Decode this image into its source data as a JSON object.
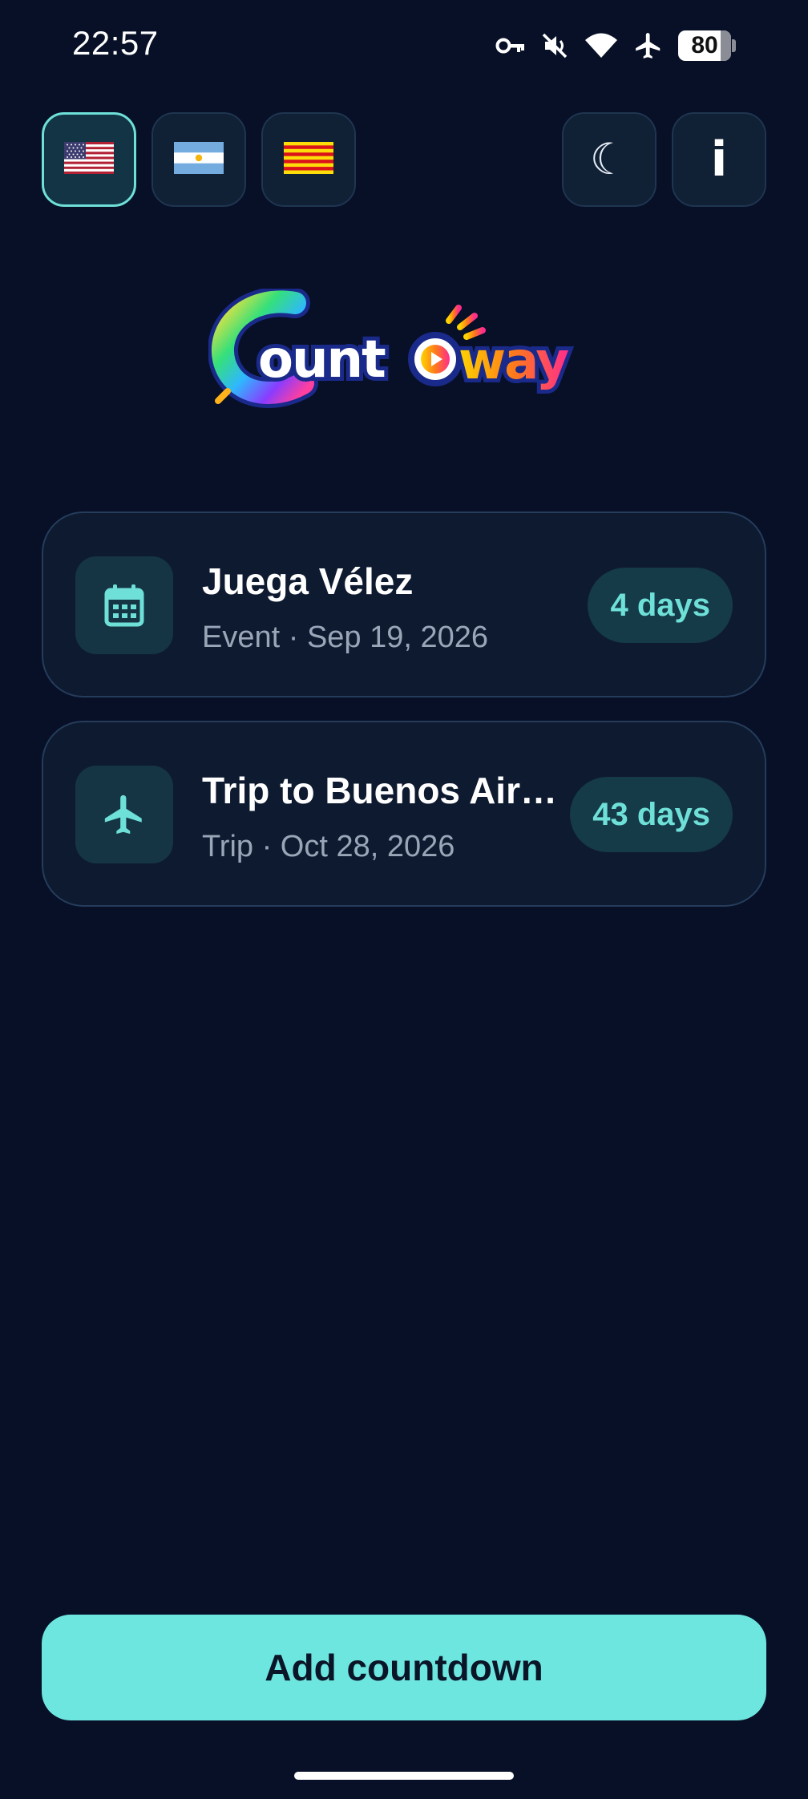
{
  "status_bar": {
    "time": "22:57",
    "battery_level": "80",
    "icons": [
      "vpn-key-icon",
      "mute-icon",
      "wifi-icon",
      "airplane-mode-icon",
      "battery-icon"
    ]
  },
  "toolbar": {
    "languages": [
      {
        "name": "us-flag-icon",
        "selected": true
      },
      {
        "name": "argentina-flag-icon",
        "selected": false
      },
      {
        "name": "catalonia-flag-icon",
        "selected": false
      }
    ],
    "theme_glyph": "☾",
    "info_glyph": "i"
  },
  "logo": {
    "text": "CountAway"
  },
  "countdowns": [
    {
      "icon": "calendar-icon",
      "title": "Juega Vélez",
      "subtitle": "Event · Sep 19, 2026",
      "remaining": "4 days"
    },
    {
      "icon": "airplane-icon",
      "title": "Trip to Buenos Air…",
      "subtitle": "Trip · Oct 28, 2026",
      "remaining": "43 days"
    }
  ],
  "add_button": {
    "label": "Add countdown"
  },
  "colors": {
    "background": "#071026",
    "card": "#0e1a30",
    "accent": "#6ee6e0",
    "muted_text": "#9aa6b8"
  }
}
